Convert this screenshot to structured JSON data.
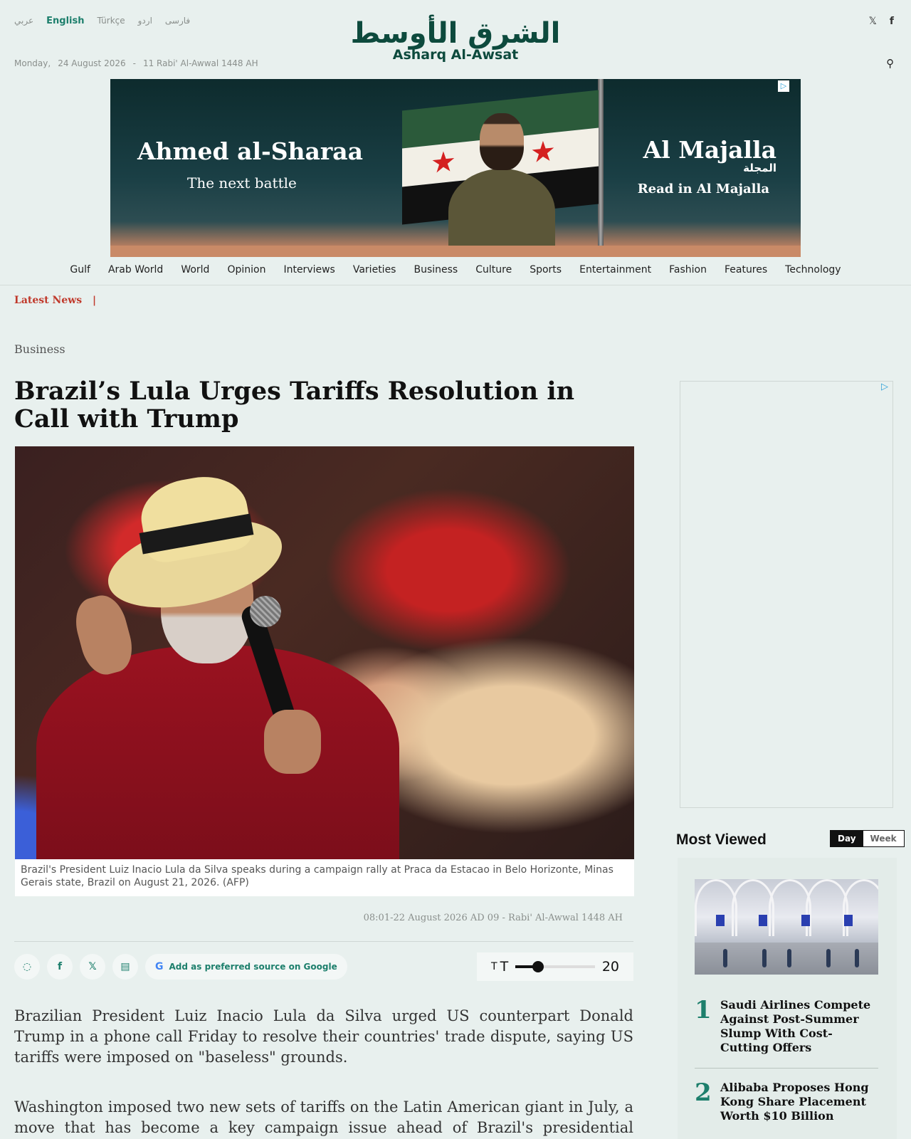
{
  "languages": [
    "عربي",
    "English",
    "Türkçe",
    "اردو",
    "فارسی"
  ],
  "active_language": "English",
  "date": {
    "weekday": "Monday,",
    "gregorian": "24 August 2026",
    "separator": "-",
    "hijri": "11 Rabi' Al-Awwal 1448 AH"
  },
  "logo": {
    "arabic": "الشرق الأوسط",
    "english": "Asharq Al-Awsat"
  },
  "social_top": {
    "x": "𝕏",
    "facebook": "f"
  },
  "search_icon": "⚲",
  "banner": {
    "left_title": "Ahmed al-Sharaa",
    "left_subtitle": "The next battle",
    "right_title": "Al Majalla",
    "right_arabic": "المجلة",
    "right_subtitle": "Read in Al Majalla",
    "ad_mark": "▷"
  },
  "nav": [
    "Gulf",
    "Arab World",
    "World",
    "Opinion",
    "Interviews",
    "Varieties",
    "Business",
    "Culture",
    "Sports",
    "Entertainment",
    "Fashion",
    "Features",
    "Technology"
  ],
  "latest_news": {
    "label": "Latest News",
    "separator": "|"
  },
  "article": {
    "section": "Business",
    "headline": "Brazil’s Lula Urges Tariffs Resolution in Call with Trump",
    "caption": "Brazil's President Luiz Inacio Lula da Silva speaks during a campaign rally at Praca da Estacao in Belo Horizonte, Minas Gerais state, Brazil on August 21, 2026. (AFP)",
    "timestamp": "08:01-22 August 2026 AD 09 - Rabi' Al-Awwal 1448 AH",
    "paragraphs": [
      "Brazilian President Luiz Inacio Lula da Silva urged US counterpart Donald Trump in a phone call Friday to resolve their countries' trade dispute, saying US tariffs were imposed on \"baseless\" grounds.",
      "Washington imposed two new sets of tariffs on the Latin American giant in July, a move that has become a key campaign issue ahead of Brazil's presidential election in October."
    ]
  },
  "share": {
    "whatsapp": "◌",
    "facebook": "f",
    "x": "𝕏",
    "print": "▤",
    "google_icon": "G",
    "google_label": "Add as preferred source on Google"
  },
  "font_size": {
    "small_t": "T",
    "large_t": "T",
    "value": "20",
    "min": 12,
    "max": 40
  },
  "sidebar": {
    "ad_mark": "▷",
    "most_viewed_title": "Most Viewed",
    "toggle": {
      "day": "Day",
      "week": "Week"
    },
    "items": [
      {
        "rank": "1",
        "title": "Saudi Airlines Compete Against Post-Summer Slump With Cost-Cutting Offers"
      },
      {
        "rank": "2",
        "title": "Alibaba Proposes Hong Kong Share Placement Worth $10 Billion"
      }
    ]
  },
  "colors": {
    "accent": "#1d7f6c",
    "latest": "#c0392b",
    "background": "#e8f0ee"
  }
}
